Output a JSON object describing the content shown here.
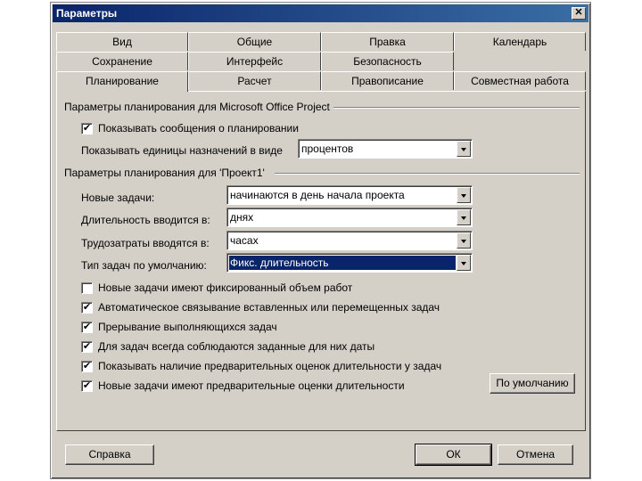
{
  "window": {
    "title": "Параметры"
  },
  "tabs": {
    "row1": [
      "Вид",
      "Общие",
      "Правка",
      "Календарь"
    ],
    "row2": [
      "Сохранение",
      "Интерфейс",
      "Безопасность"
    ],
    "row3": [
      "Планирование",
      "Расчет",
      "Правописание",
      "Совместная работа"
    ]
  },
  "group1": {
    "title": "Параметры планирования для Microsoft Office Project",
    "show_messages": {
      "label": "Показывать сообщения о планировании",
      "checked": true
    },
    "units_label": "Показывать единицы назначений в виде",
    "units_value": "процентов"
  },
  "group2": {
    "title": "Параметры планирования для 'Проект1'",
    "new_tasks_label": "Новые задачи:",
    "new_tasks_value": "начинаются в день начала проекта",
    "duration_label": "Длительность вводится в:",
    "duration_value": "днях",
    "work_label": "Трудозатраты вводятся в:",
    "work_value": "часах",
    "task_type_label": "Тип задач по умолчанию:",
    "task_type_value": "Фикс. длительность",
    "checks": [
      {
        "label": "Новые задачи имеют фиксированный объем работ",
        "checked": false
      },
      {
        "label": "Автоматическое связывание вставленных или перемещенных задач",
        "checked": true
      },
      {
        "label": "Прерывание выполняющихся задач",
        "checked": true
      },
      {
        "label": "Для задач всегда соблюдаются заданные для них даты",
        "checked": true
      },
      {
        "label": "Показывать наличие предварительных оценок длительности у задач",
        "checked": true
      },
      {
        "label": "Новые задачи имеют предварительные оценки длительности",
        "checked": true
      }
    ],
    "default_button": "По умолчанию"
  },
  "footer": {
    "help": "Справка",
    "ok": "ОК",
    "cancel": "Отмена"
  }
}
